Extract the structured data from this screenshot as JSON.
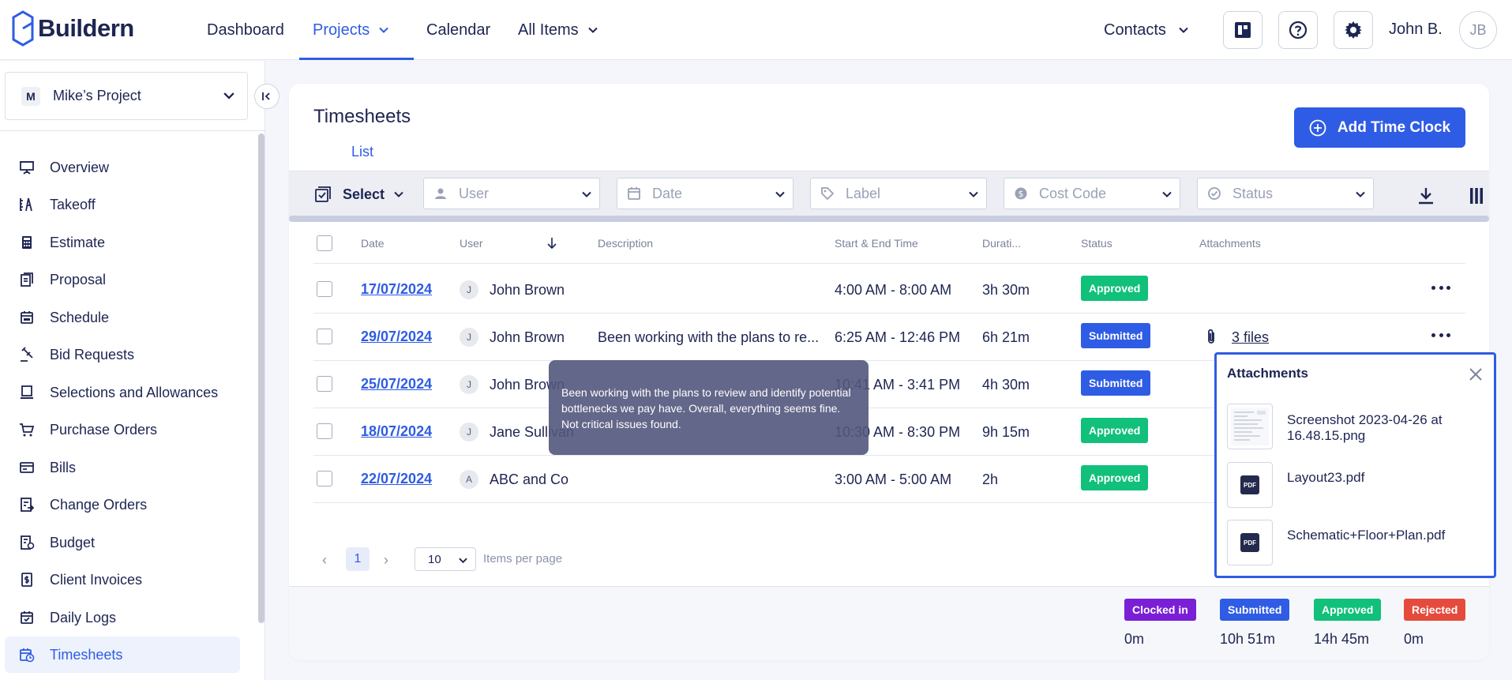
{
  "app": {
    "name": "Buildern"
  },
  "nav": {
    "dashboard": "Dashboard",
    "projects": "Projects",
    "calendar": "Calendar",
    "all_items": "All Items",
    "contacts": "Contacts"
  },
  "user": {
    "name": "John B.",
    "initials": "JB"
  },
  "project": {
    "badge": "M",
    "name": "Mike’s Project"
  },
  "sidebar": {
    "items": [
      {
        "label": "Overview",
        "icon": "presentation-icon"
      },
      {
        "label": "Takeoff",
        "icon": "takeoff-icon"
      },
      {
        "label": "Estimate",
        "icon": "calculator-icon"
      },
      {
        "label": "Proposal",
        "icon": "proposal-icon"
      },
      {
        "label": "Schedule",
        "icon": "calendar-icon"
      },
      {
        "label": "Bid Requests",
        "icon": "gavel-icon"
      },
      {
        "label": "Selections and Allowances",
        "icon": "selections-icon"
      },
      {
        "label": "Purchase Orders",
        "icon": "cart-icon"
      },
      {
        "label": "Bills",
        "icon": "bills-icon"
      },
      {
        "label": "Change Orders",
        "icon": "change-orders-icon"
      },
      {
        "label": "Budget",
        "icon": "budget-icon"
      },
      {
        "label": "Client Invoices",
        "icon": "invoice-icon"
      },
      {
        "label": "Daily Logs",
        "icon": "daily-logs-icon"
      },
      {
        "label": "Timesheets",
        "icon": "timesheets-icon",
        "active": true
      }
    ]
  },
  "page": {
    "title": "Timesheets",
    "tab": "List",
    "add_button": "Add Time Clock"
  },
  "filters": {
    "select": "Select",
    "user": "User",
    "date": "Date",
    "label": "Label",
    "cost_code": "Cost Code",
    "status": "Status"
  },
  "table": {
    "headers": {
      "date": "Date",
      "user": "User",
      "description": "Description",
      "time": "Start & End Time",
      "duration": "Durati...",
      "status": "Status",
      "attachments": "Attachments"
    },
    "rows": [
      {
        "date": "17/07/2024",
        "initial": "J",
        "user": "John Brown",
        "description": "",
        "time": "4:00 AM - 8:00 AM",
        "duration": "3h 30m",
        "status": "Approved",
        "attachments": ""
      },
      {
        "date": "29/07/2024",
        "initial": "J",
        "user": "John Brown",
        "description": "Been working with the plans to re...",
        "time": "6:25 AM - 12:46 PM",
        "duration": "6h 21m",
        "status": "Submitted",
        "attachments": "3 files"
      },
      {
        "date": "25/07/2024",
        "initial": "J",
        "user": "John Brown",
        "description": "",
        "time": "10:41 AM - 3:41 PM",
        "duration": "4h 30m",
        "status": "Submitted",
        "attachments": ""
      },
      {
        "date": "18/07/2024",
        "initial": "J",
        "user": "Jane Sullivan",
        "description": "",
        "time": "10:30 AM - 8:30 PM",
        "duration": "9h 15m",
        "status": "Approved",
        "attachments": ""
      },
      {
        "date": "22/07/2024",
        "initial": "A",
        "user": "ABC and Co",
        "description": "",
        "time": "3:00 AM - 5:00 AM",
        "duration": "2h",
        "status": "Approved",
        "attachments": ""
      }
    ]
  },
  "pagination": {
    "page": "1",
    "per_page": "10",
    "per_page_label": "Items per page"
  },
  "summary": [
    {
      "label": "Clocked in",
      "value": "0m"
    },
    {
      "label": "Submitted",
      "value": "10h 51m"
    },
    {
      "label": "Approved",
      "value": "14h 45m"
    },
    {
      "label": "Rejected",
      "value": "0m"
    }
  ],
  "tooltip": {
    "text": "Been working with the plans to review and identify potential bottlenecks we pay have. Overall, everything seems fine. Not critical issues found."
  },
  "attachments_popover": {
    "title": "Attachments",
    "files": [
      {
        "name": "Screenshot 2023-04-26 at 16.48.15.png",
        "type": "image"
      },
      {
        "name": "Layout23.pdf",
        "type": "PDF"
      },
      {
        "name": "Schematic+Floor+Plan.pdf",
        "type": "PDF"
      }
    ]
  },
  "colors": {
    "primary": "#2f5ce4",
    "approved": "#11c07a",
    "clocked_in": "#7a1fd6",
    "rejected": "#e54b3c",
    "navy": "#1d2552"
  }
}
